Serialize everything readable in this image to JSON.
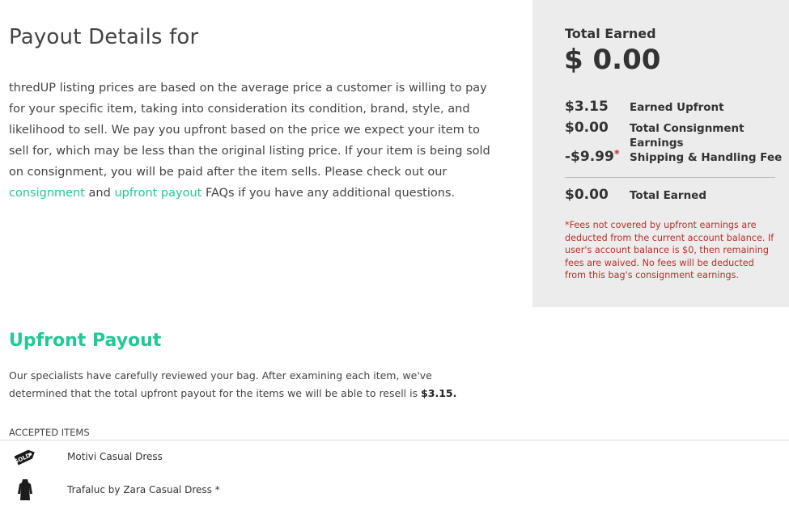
{
  "header": {
    "title": "Payout Details for"
  },
  "intro": {
    "text_before": "thredUP listing prices are based on the average price a customer is willing to pay for your specific item, taking into consideration its condition, brand, style, and likelihood to sell. We pay you upfront based on the price we expect your item to sell for, which may be less than the original listing price. If your item is being sold on consignment, you will be paid after the item sells. Please check out our ",
    "consignment_link": "consignment",
    "and_text": " and ",
    "upfront_link": "upfront payout",
    "text_after": " FAQs if you have any additional questions."
  },
  "summary": {
    "total_label": "Total Earned",
    "total_value": "$ 0.00",
    "rows": [
      {
        "amount": "$3.15",
        "label": "Earned Upfront"
      },
      {
        "amount": "$0.00",
        "label": "Total Consignment Earnings"
      },
      {
        "amount": "-$9.99",
        "asterisk": "*",
        "label": "Shipping & Handling Fee"
      }
    ],
    "bottom_amount": "$0.00",
    "bottom_label": "Total Earned",
    "note": "*Fees not covered by upfront earnings are deducted from the current account balance. If user's account balance is $0, then remaining fees are waived. No fees will be deducted from this bag's consignment earnings.",
    "note_color": "#b5302a"
  },
  "upfront": {
    "heading": "Upfront Payout",
    "text": "Our specialists have carefully reviewed your bag. After examining each item, we've determined that the total upfront payout for the items we will be able to resell is ",
    "amount": "$3.15."
  },
  "accepted": {
    "header": "ACCEPTED ITEMS",
    "items": [
      {
        "name": "Motivi Casual Dress",
        "icon": "sold-tag-icon"
      },
      {
        "name": "Trafaluc by Zara Casual Dress *",
        "icon": "dress-icon"
      }
    ]
  },
  "colors": {
    "accent": "#20c997",
    "panel_bg": "#ececec"
  }
}
